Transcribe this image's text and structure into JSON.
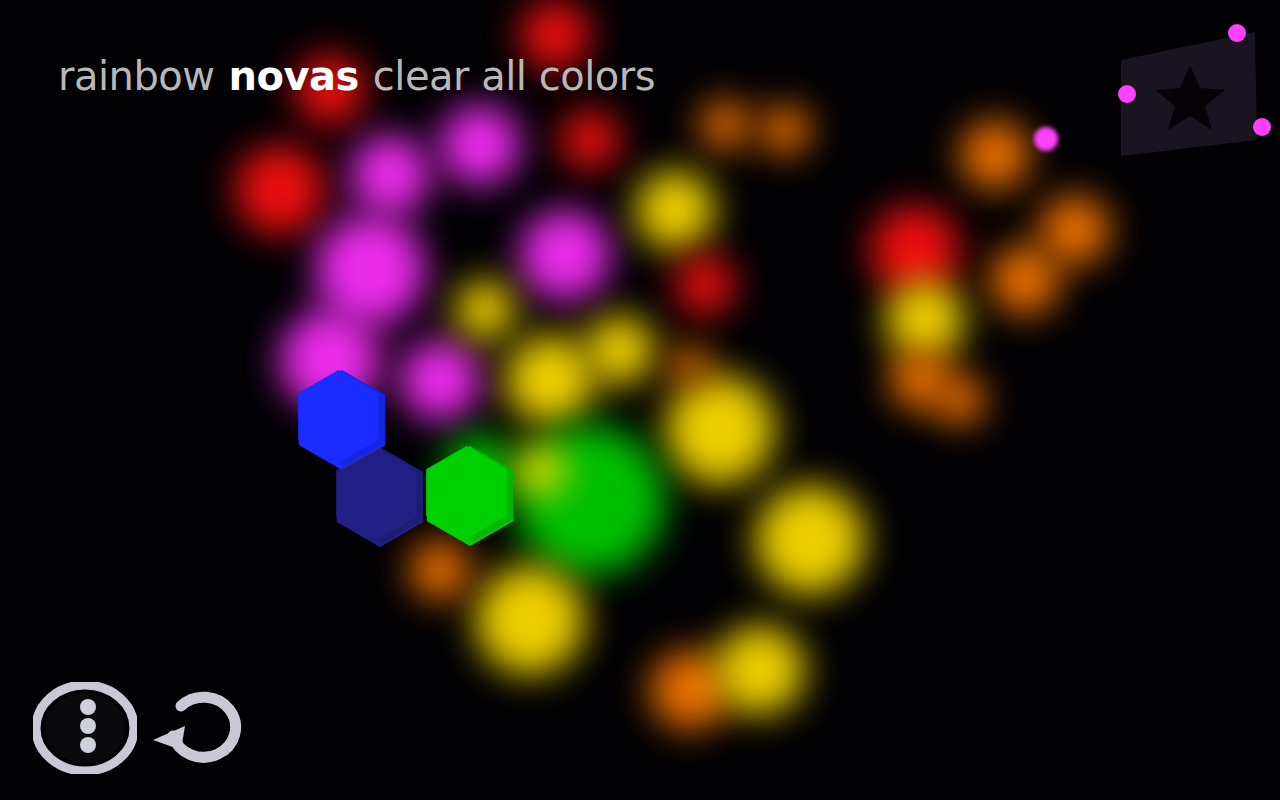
{
  "title": [
    {
      "text": "rainbow",
      "highlighted": false
    },
    {
      "text": "novas",
      "highlighted": true
    },
    {
      "text": "clear all colors",
      "highlighted": false
    }
  ],
  "blobs": [
    {
      "color": "#ff1010"
    },
    {
      "color": "#ff1010"
    },
    {
      "color": "#ff1010"
    },
    {
      "color": "#ff1010"
    },
    {
      "color": "#ff30ff"
    },
    {
      "color": "#ff30ff"
    },
    {
      "color": "#ff30ff"
    },
    {
      "color": "#ff30ff"
    },
    {
      "color": "#ff30ff"
    },
    {
      "color": "#ff30ff"
    },
    {
      "color": "#ffe000"
    },
    {
      "color": "#ff7a00"
    },
    {
      "color": "#ff7a00"
    },
    {
      "color": "#ff1010"
    },
    {
      "color": "#ffe000"
    },
    {
      "color": "#ffe000"
    },
    {
      "color": "#ffe000"
    },
    {
      "color": "#ffe000"
    },
    {
      "color": "#00d000"
    },
    {
      "color": "#00d000"
    },
    {
      "color": "#ffe000"
    },
    {
      "color": "#ffe000"
    },
    {
      "color": "#ffe000"
    },
    {
      "color": "#ff7a00"
    },
    {
      "color": "#ff7a00"
    },
    {
      "color": "#ffe000"
    },
    {
      "color": "#ff7a00"
    },
    {
      "color": "#ff7a00"
    },
    {
      "color": "#ff7a00"
    },
    {
      "color": "#ff1010"
    },
    {
      "color": "#ffe000"
    },
    {
      "color": "#ff7a00"
    },
    {
      "color": "#ff7a00"
    },
    {
      "color": "#ff7a00"
    }
  ],
  "hexes": [
    {
      "color": "#1a2cff",
      "dim": false
    },
    {
      "color": "#2a2ab0",
      "dim": true
    },
    {
      "color": "#00d000",
      "dim": false
    }
  ]
}
